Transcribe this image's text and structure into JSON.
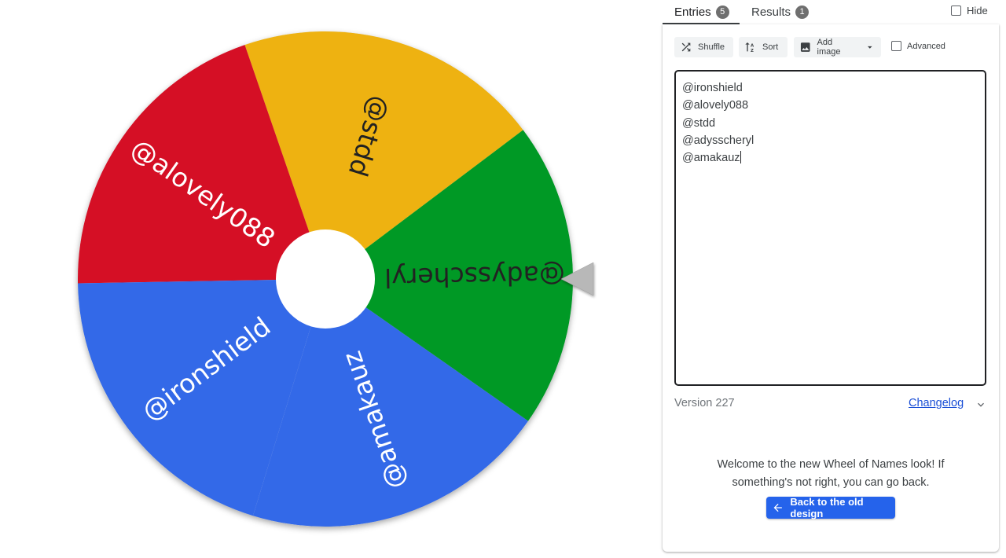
{
  "tabs": [
    {
      "label": "Entries",
      "count": "5"
    },
    {
      "label": "Results",
      "count": "1"
    }
  ],
  "hide_label": "Hide",
  "toolbar": {
    "shuffle_label": "Shuffle",
    "sort_label": "Sort",
    "add_image_label": "Add image",
    "advanced_label": "Advanced"
  },
  "entries": [
    "@ironshield",
    "@alovely088",
    "@stdd",
    "@adysscheryl",
    "@amakauz"
  ],
  "version_text": "Version 227",
  "changelog_label": "Changelog",
  "welcome": {
    "line1": "Welcome to the new Wheel of Names look! If",
    "line2": "something's not right, you can go back.",
    "button_label": "Back to the old design"
  },
  "wheel": {
    "segments": [
      {
        "label": "@stdd",
        "color": "#eeb211",
        "text_color": "#222222"
      },
      {
        "label": "@alovely088",
        "color": "#d50f25",
        "text_color": "#ffffff"
      },
      {
        "label": "@ironshield",
        "color": "#3369e8",
        "text_color": "#ffffff"
      },
      {
        "label": "@amakauz",
        "color": "#3369e8",
        "text_color": "#ffffff"
      },
      {
        "label": "@adysscheryl",
        "color": "#009925",
        "text_color": "#222222"
      }
    ],
    "center_color": "#ffffff",
    "pointer_color": "#b8b8b8"
  },
  "colors": {
    "accent": "#2563eb",
    "link": "#1a4fd6"
  },
  "icons": {
    "shuffle": "shuffle-icon",
    "sort": "sort-icon",
    "add_image": "image-icon",
    "dropdown": "caret-down-icon",
    "changelog_expand": "chevron-down-icon",
    "back": "arrow-left-icon"
  }
}
